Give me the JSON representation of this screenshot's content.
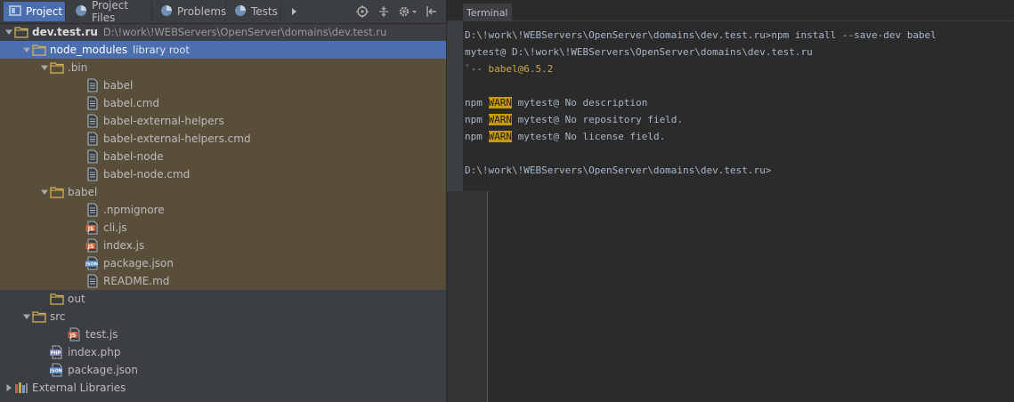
{
  "tabs": [
    {
      "label": "Project",
      "active": true,
      "icon": "project-icon"
    },
    {
      "label": "Project Files",
      "active": false,
      "icon": "project-files-icon"
    },
    {
      "label": "Problems",
      "active": false,
      "icon": "problems-icon"
    },
    {
      "label": "Tests",
      "active": false,
      "icon": "tests-icon"
    }
  ],
  "tree": [
    {
      "label": "dev.test.ru",
      "sub": "D:\\!work\\!WEBServers\\OpenServer\\domains\\dev.test.ru",
      "depth": 0,
      "arrow": "down",
      "icon": "folder",
      "bold": true
    },
    {
      "label": "node_modules",
      "sub": "library root",
      "depth": 1,
      "arrow": "down",
      "icon": "folder",
      "selected": true
    },
    {
      "label": ".bin",
      "depth": 2,
      "arrow": "down",
      "icon": "folder",
      "brown": true
    },
    {
      "label": "babel",
      "depth": 4,
      "icon": "file",
      "brown": true
    },
    {
      "label": "babel.cmd",
      "depth": 4,
      "icon": "file",
      "brown": true
    },
    {
      "label": "babel-external-helpers",
      "depth": 4,
      "icon": "file",
      "brown": true
    },
    {
      "label": "babel-external-helpers.cmd",
      "depth": 4,
      "icon": "file",
      "brown": true
    },
    {
      "label": "babel-node",
      "depth": 4,
      "icon": "file",
      "brown": true
    },
    {
      "label": "babel-node.cmd",
      "depth": 4,
      "icon": "file",
      "brown": true
    },
    {
      "label": "babel",
      "depth": 2,
      "arrow": "down",
      "icon": "folder",
      "brown": true
    },
    {
      "label": ".npmignore",
      "depth": 4,
      "icon": "file",
      "brown": true
    },
    {
      "label": "cli.js",
      "depth": 4,
      "icon": "js",
      "brown": true
    },
    {
      "label": "index.js",
      "depth": 4,
      "icon": "js",
      "brown": true
    },
    {
      "label": "package.json",
      "depth": 4,
      "icon": "json",
      "brown": true
    },
    {
      "label": "README.md",
      "depth": 4,
      "icon": "file",
      "brown": true
    },
    {
      "label": "out",
      "depth": 2,
      "icon": "folder"
    },
    {
      "label": "src",
      "depth": 1,
      "arrow": "down",
      "icon": "folder"
    },
    {
      "label": "test.js",
      "depth": 3,
      "icon": "js"
    },
    {
      "label": "index.php",
      "depth": 2,
      "icon": "php"
    },
    {
      "label": "package.json",
      "depth": 2,
      "icon": "json"
    },
    {
      "label": "External Libraries",
      "depth": 0,
      "arrow": "right",
      "icon": "libraries"
    }
  ],
  "terminal": {
    "tab_label": "Terminal",
    "lines": [
      [
        {
          "t": "D:\\!work\\!WEBServers\\OpenServer\\domains\\dev.test.ru>npm install --save-dev babel"
        }
      ],
      [
        {
          "t": "mytest@ D:\\!work\\!WEBServers\\OpenServer\\domains\\dev.test.ru"
        }
      ],
      [
        {
          "t": "`-- "
        },
        {
          "t": "babel@6.5.2",
          "c": "yel"
        }
      ],
      [],
      [
        {
          "t": "npm "
        },
        {
          "t": "WARN",
          "c": "warn"
        },
        {
          "t": " mytest@ No description"
        }
      ],
      [
        {
          "t": "npm "
        },
        {
          "t": "WARN",
          "c": "warn"
        },
        {
          "t": " mytest@ No repository field."
        }
      ],
      [
        {
          "t": "npm "
        },
        {
          "t": "WARN",
          "c": "warn"
        },
        {
          "t": " mytest@ No license field."
        }
      ],
      [],
      [
        {
          "t": "D:\\!work\\!WEBServers\\OpenServer\\domains\\dev.test.ru>"
        }
      ]
    ]
  }
}
